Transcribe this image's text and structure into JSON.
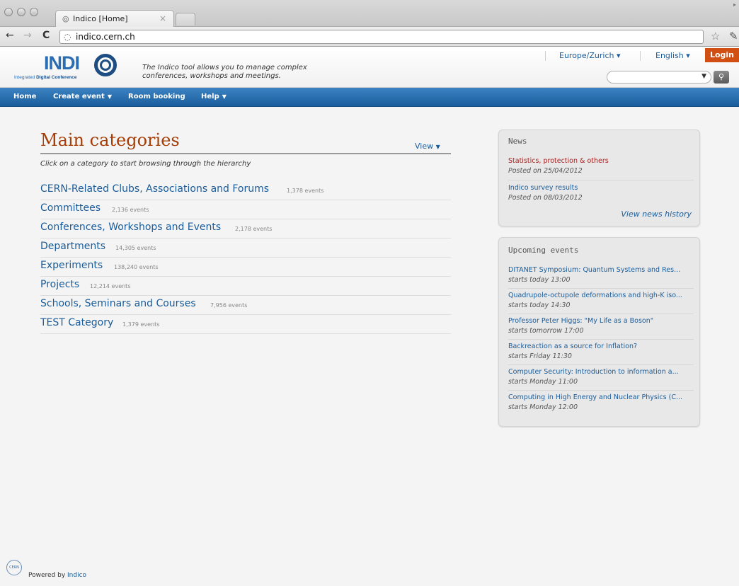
{
  "browser": {
    "tab_title": "Indico [Home]",
    "tab_close": "×",
    "url": "indico.cern.ch"
  },
  "header": {
    "logo": "INDICO",
    "logo_sub_prefix": "Integrated ",
    "logo_sub_bold": "Digital Conference",
    "tagline": "The Indico tool allows you to manage complex conferences, workshops and meetings.",
    "timezone": "Europe/Zurich",
    "language": "English",
    "login": "Login"
  },
  "nav": [
    {
      "label": "Home",
      "dropdown": false
    },
    {
      "label": "Create event",
      "dropdown": true
    },
    {
      "label": "Room booking",
      "dropdown": false
    },
    {
      "label": "Help",
      "dropdown": true
    }
  ],
  "main": {
    "title": "Main categories",
    "view": "View",
    "subtitle": "Click on a category to start browsing through the hierarchy",
    "categories": [
      {
        "name": "CERN-Related Clubs, Associations and Forums",
        "count": "1,378 events"
      },
      {
        "name": "Committees",
        "count": "2,136 events"
      },
      {
        "name": "Conferences, Workshops and Events",
        "count": "2,178 events"
      },
      {
        "name": "Departments",
        "count": "14,305 events"
      },
      {
        "name": "Experiments",
        "count": "138,240 events"
      },
      {
        "name": "Projects",
        "count": "12,214 events"
      },
      {
        "name": "Schools, Seminars and Courses",
        "count": "7,956 events"
      },
      {
        "name": "TEST Category",
        "count": "1,379 events"
      }
    ]
  },
  "news": {
    "title": "News",
    "items": [
      {
        "title": "Statistics, protection & others",
        "posted": "Posted on 25/04/2012",
        "color": "#a4201c"
      },
      {
        "title": "Indico survey results",
        "posted": "Posted on 08/03/2012",
        "color": "#1a5c9a"
      }
    ],
    "history": "View news history"
  },
  "upcoming": {
    "title": "Upcoming events",
    "items": [
      {
        "title": "DITANET Symposium: Quantum Systems and Res...",
        "when": "starts today 13:00"
      },
      {
        "title": "Quadrupole-octupole deformations and high-K iso...",
        "when": "starts today 14:30"
      },
      {
        "title": "Professor Peter Higgs: \"My Life as a Boson\"",
        "when": "starts tomorrow 17:00"
      },
      {
        "title": "Backreaction as a source for Inflation?",
        "when": "starts Friday 11:30"
      },
      {
        "title": "Computer Security: Introduction to information a...",
        "when": "starts Monday 11:00"
      },
      {
        "title": "Computing in High Energy and Nuclear Physics (C...",
        "when": "starts Monday 12:00"
      }
    ]
  },
  "footer": {
    "cern": "CERN",
    "powered_prefix": "Powered by ",
    "powered_link": "Indico"
  },
  "colors": {
    "accent_title": "#a63d05",
    "link": "#1a5c9a",
    "nav_blue": "#1a5d9c",
    "login_orange": "#d14f12"
  }
}
